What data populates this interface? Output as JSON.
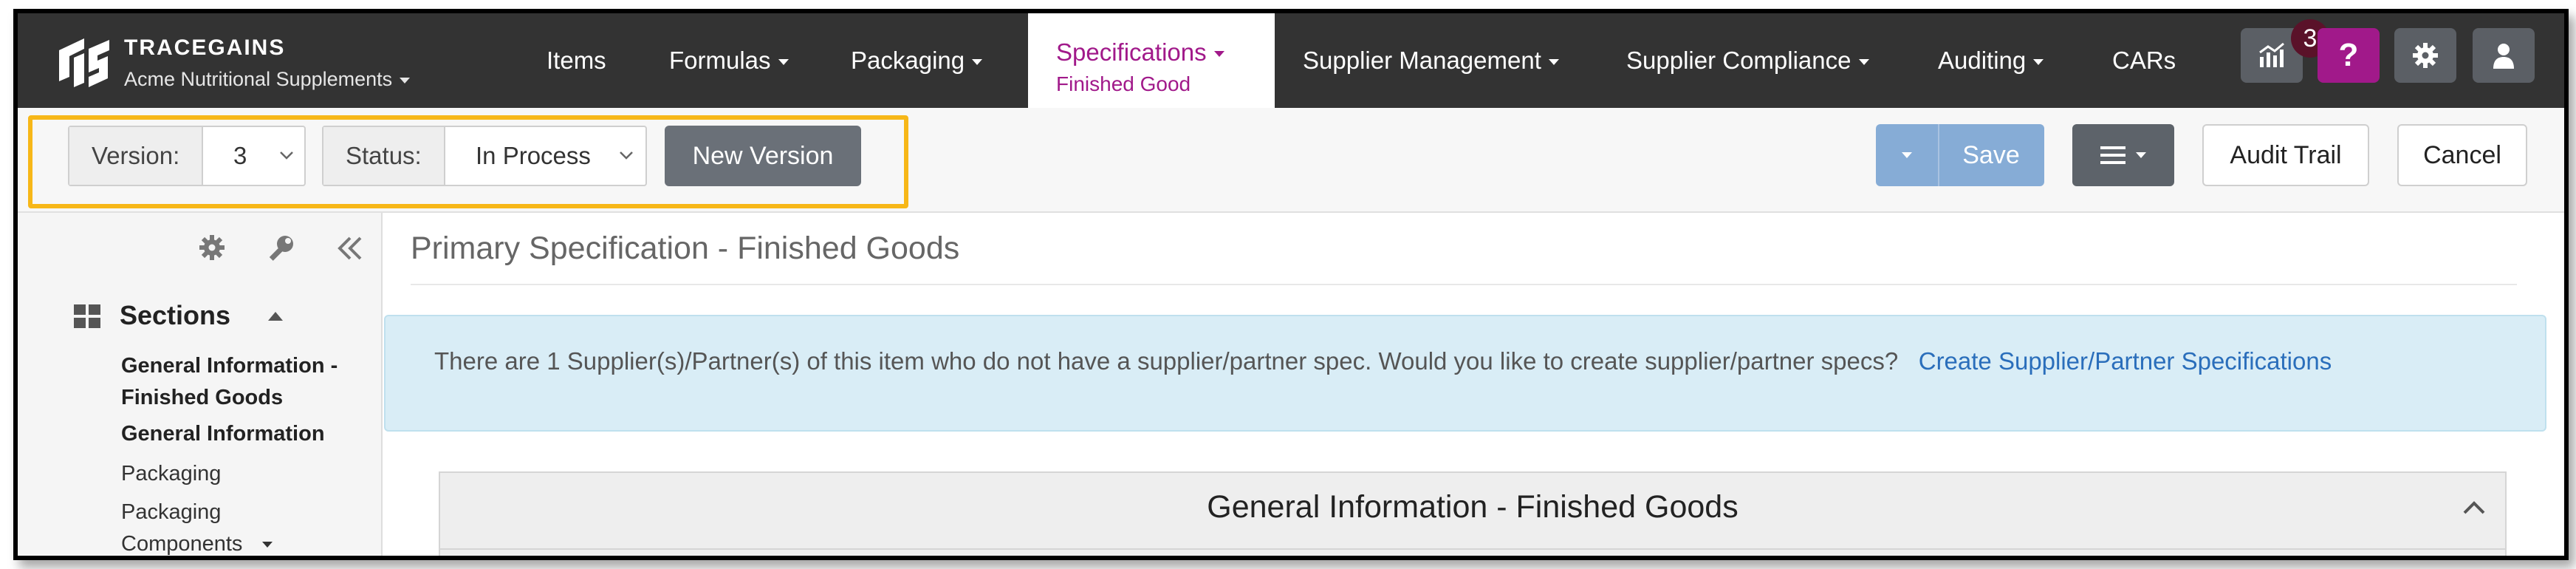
{
  "brand": {
    "name": "TRACEGAINS",
    "org": "Acme Nutritional Supplements"
  },
  "nav": {
    "items": [
      "Items",
      "Formulas",
      "Packaging",
      "Supplier Management",
      "Supplier Compliance",
      "Auditing",
      "CARs"
    ],
    "active": {
      "title": "Specifications",
      "subtitle": "Finished Good"
    },
    "notification_count": "3",
    "help_glyph": "?"
  },
  "toolbar": {
    "version_label": "Version:",
    "version_value": "3",
    "status_label": "Status:",
    "status_value": "In Process",
    "new_version_label": "New Version",
    "save_label": "Save",
    "audit_trail_label": "Audit Trail",
    "cancel_label": "Cancel"
  },
  "sidebar": {
    "sections_label": "Sections",
    "items": [
      {
        "label": "General Information - Finished Goods",
        "bold": true
      },
      {
        "label": "General Information",
        "bold": true
      },
      {
        "label": "Packaging",
        "bold": false
      },
      {
        "label": "Packaging Components",
        "bold": false
      }
    ]
  },
  "main": {
    "page_title": "Primary Specification - Finished Goods",
    "alert_text": "There are 1 Supplier(s)/Partner(s) of this item who do not have a supplier/partner spec. Would you like to create supplier/partner specs?",
    "alert_link": "Create Supplier/Partner Specifications",
    "panel_title": "General Information - Finished Goods"
  },
  "colors": {
    "accent": "#a1198a",
    "highlight": "#f7b718",
    "nav_bg": "#333333",
    "link": "#2a6ebb"
  }
}
